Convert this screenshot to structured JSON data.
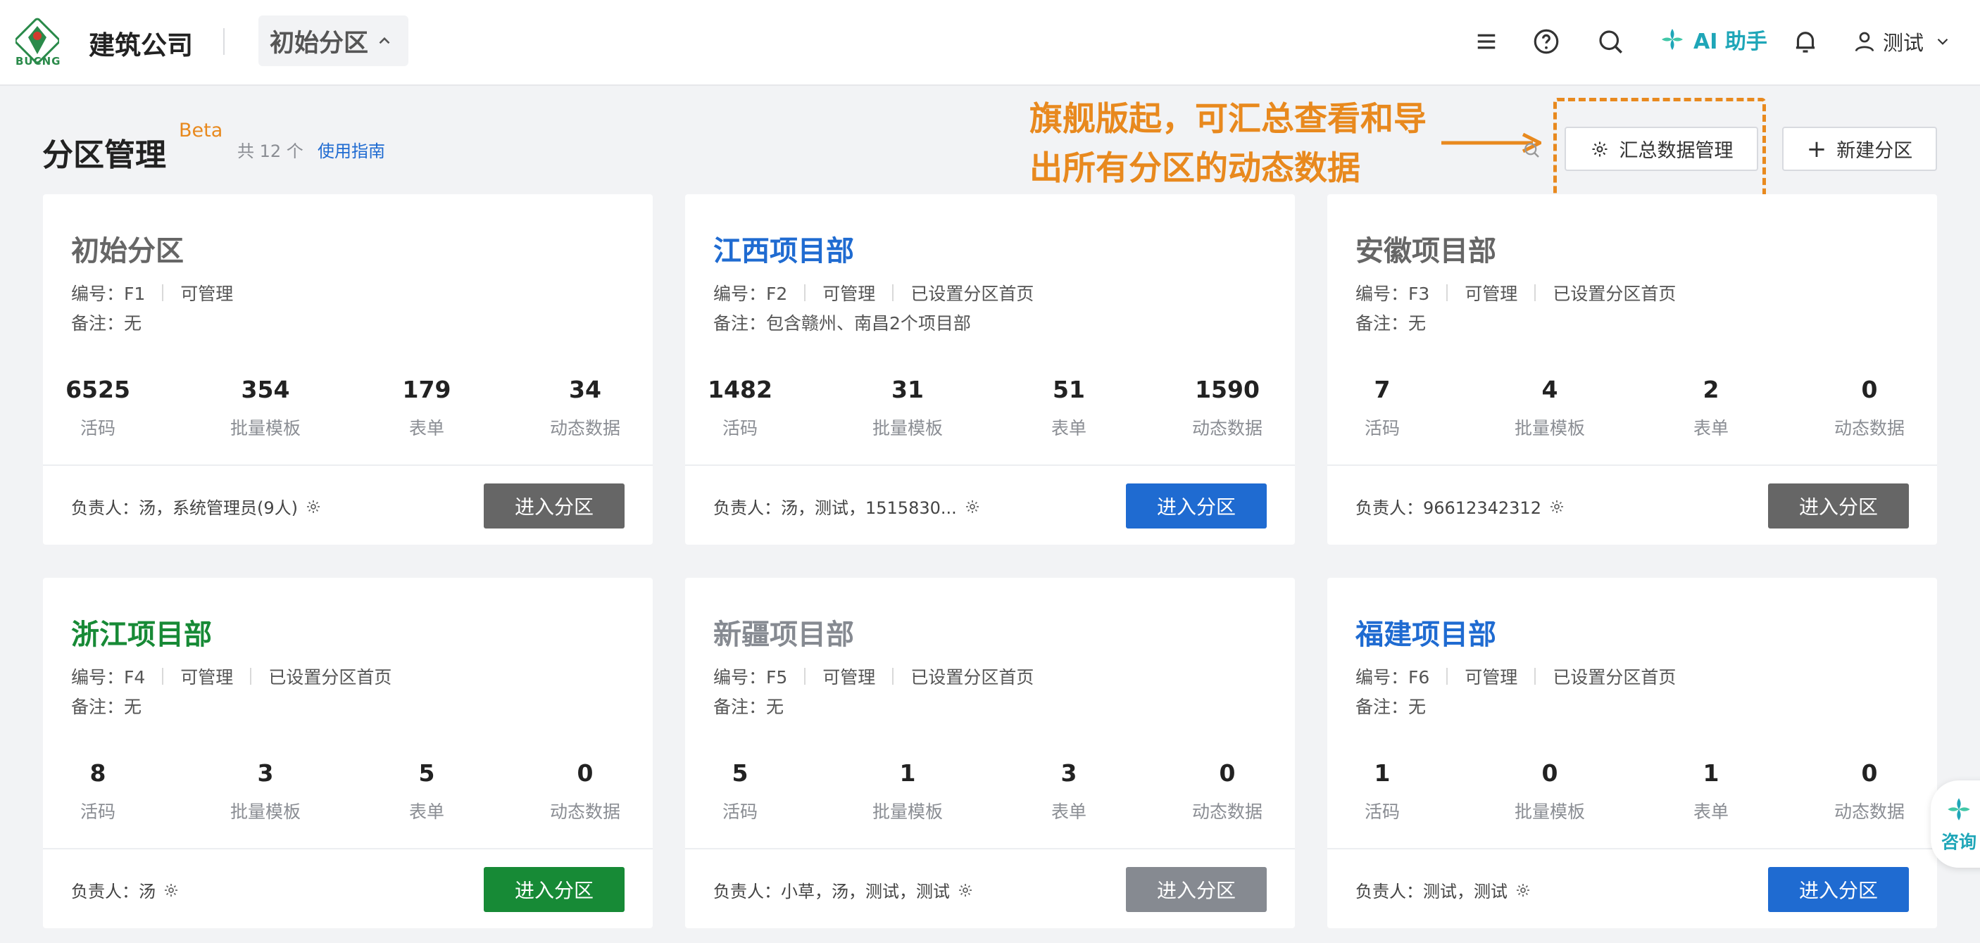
{
  "header": {
    "logo_text": "BUCNG",
    "company": "建筑公司",
    "zone_selector": "初始分区",
    "ai_label": "AI 助手",
    "user_name": "测试",
    "icons": [
      "menu-icon",
      "help-icon",
      "search-icon",
      "ai-assistant-icon",
      "bell-icon",
      "user-icon"
    ]
  },
  "page": {
    "title": "分区管理",
    "beta": "Beta",
    "count": "共 12 个",
    "guide": "使用指南",
    "annotation": "旗舰版起，可汇总查看和导出所有分区的动态数据",
    "summary_button": "汇总数据管理",
    "new_button": "新建分区"
  },
  "colors": {
    "blue": "#1f6bd1",
    "green": "#178a36",
    "dark_gray": "#666666",
    "light_gray": "#868a91",
    "orange": "#e8891e",
    "ai_teal": "#1fa6b8"
  },
  "stat_labels": [
    "活码",
    "批量模板",
    "表单",
    "动态数据"
  ],
  "enter_label": "进入分区",
  "cards": [
    {
      "name": "初始分区",
      "name_color": "#666666",
      "code": "编号：F1",
      "manage": "可管理",
      "homepage": "",
      "note": "备注：无",
      "stats": [
        "6525",
        "354",
        "179",
        "34"
      ],
      "owner": "负责人：汤，系统管理员(9人)",
      "button_color": "#666666"
    },
    {
      "name": "江西项目部",
      "name_color": "#1f6bd1",
      "code": "编号：F2",
      "manage": "可管理",
      "homepage": "已设置分区首页",
      "note": "备注：包含赣州、南昌2个项目部",
      "stats": [
        "1482",
        "31",
        "51",
        "1590"
      ],
      "owner": "负责人：汤，测试，1515830...",
      "button_color": "#1f6bd1"
    },
    {
      "name": "安徽项目部",
      "name_color": "#666666",
      "code": "编号：F3",
      "manage": "可管理",
      "homepage": "已设置分区首页",
      "note": "备注：无",
      "stats": [
        "7",
        "4",
        "2",
        "0"
      ],
      "owner": "负责人：96612342312",
      "button_color": "#666666"
    },
    {
      "name": "浙江项目部",
      "name_color": "#178a36",
      "code": "编号：F4",
      "manage": "可管理",
      "homepage": "已设置分区首页",
      "note": "备注：无",
      "stats": [
        "8",
        "3",
        "5",
        "0"
      ],
      "owner": "负责人：汤",
      "button_color": "#178a36"
    },
    {
      "name": "新疆项目部",
      "name_color": "#868a91",
      "code": "编号：F5",
      "manage": "可管理",
      "homepage": "已设置分区首页",
      "note": "备注：无",
      "stats": [
        "5",
        "1",
        "3",
        "0"
      ],
      "owner": "负责人：小草，汤，测试，测试",
      "button_color": "#868a91"
    },
    {
      "name": "福建项目部",
      "name_color": "#1f6bd1",
      "code": "编号：F6",
      "manage": "可管理",
      "homepage": "已设置分区首页",
      "note": "备注：无",
      "stats": [
        "1",
        "0",
        "1",
        "0"
      ],
      "owner": "负责人：测试，测试",
      "button_color": "#1f6bd1"
    }
  ],
  "float_help": "咨询"
}
